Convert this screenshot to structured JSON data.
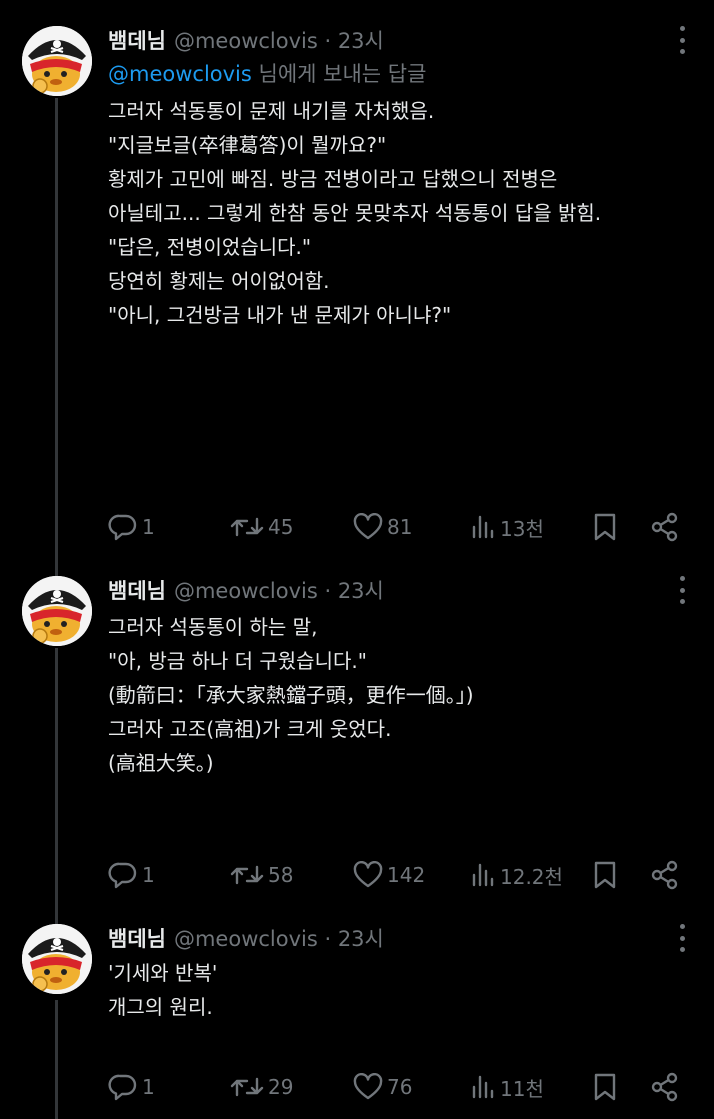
{
  "tweets": [
    {
      "name": "뱀데님",
      "handle": "@meowclovis · 23시",
      "reply_to_mention": "@meowclovis",
      "reply_to_rest": " 님에게 보내는 답글",
      "lines": [
        "그러자 석동통이 문제 내기를 자처했음.",
        "",
        "\"지글보글(卒律葛答)이 뭘까요?\"",
        "",
        "황제가 고민에 빠짐. 방금 전병이라고 답했으니 전병은",
        "아닐테고... 그렇게 한참 동안 못맞추자 석동통이 답을 밝힘.",
        "",
        "\"답은, 전병이었습니다.\"",
        "",
        "당연히 황제는 어이없어함.",
        "",
        "\"아니, 그건방금 내가 낸 문제가 아니냐?\""
      ],
      "stats": {
        "replies": "1",
        "retweets": "45",
        "likes": "81",
        "views": "13천"
      }
    },
    {
      "name": "뱀데님",
      "handle": "@meowclovis · 23시",
      "lines": [
        "그러자 석동통이 하는 말,",
        "",
        "\"아, 방금 하나 더 구웠습니다.\"",
        "(動箭曰：「承大家熱鐺子頭，更作一個。」)",
        "",
        "그러자 고조(高祖)가 크게 웃었다.",
        "(高祖大笑。)"
      ],
      "stats": {
        "replies": "1",
        "retweets": "58",
        "likes": "142",
        "views": "12.2천"
      }
    },
    {
      "name": "뱀데님",
      "handle": "@meowclovis · 23시",
      "lines": [
        "'기세와 반복'",
        "",
        "개그의 원리."
      ],
      "stats": {
        "replies": "1",
        "retweets": "29",
        "likes": "76",
        "views": "11천"
      }
    }
  ],
  "icons": {
    "reply": "reply-icon",
    "retweet": "retweet-icon",
    "like": "heart-icon",
    "views": "views-icon",
    "bookmark": "bookmark-icon",
    "share": "share-icon",
    "more": "more-icon"
  },
  "colors": {
    "background": "#000000",
    "text": "#e7e9ea",
    "muted": "#71767b",
    "link": "#1d9bf0",
    "thread_line": "#333639"
  }
}
